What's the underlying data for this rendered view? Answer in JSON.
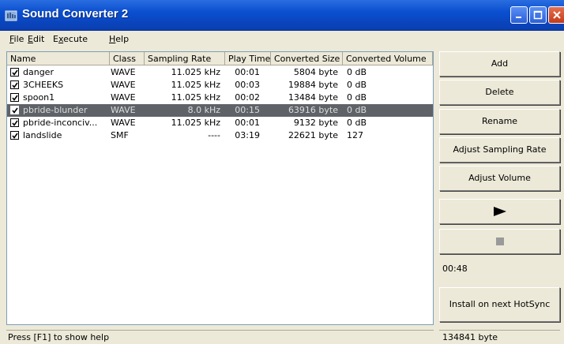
{
  "window": {
    "title": "Sound Converter 2"
  },
  "menu": [
    {
      "label": "File",
      "underline": "F",
      "rest": "ile"
    },
    {
      "label": "Edit",
      "underline": "E",
      "rest": "dit"
    },
    {
      "label": "Execute",
      "prefix": "E",
      "underline": "x",
      "rest": "ecute"
    },
    {
      "label": "Help",
      "underline": "H",
      "rest": "elp"
    }
  ],
  "list": {
    "columns": [
      "Name",
      "Class",
      "Sampling Rate",
      "Play Time",
      "Converted Size",
      "Converted Volume"
    ],
    "rows": [
      {
        "name": "danger",
        "class": "WAVE",
        "rate": "11.025 kHz",
        "time": "00:01",
        "size": "5804 byte",
        "volume": "0 dB",
        "checked": true,
        "selected": false
      },
      {
        "name": "3CHEEKS",
        "class": "WAVE",
        "rate": "11.025 kHz",
        "time": "00:03",
        "size": "19884 byte",
        "volume": "0 dB",
        "checked": true,
        "selected": false
      },
      {
        "name": "spoon1",
        "class": "WAVE",
        "rate": "11.025 kHz",
        "time": "00:02",
        "size": "13484 byte",
        "volume": "0 dB",
        "checked": true,
        "selected": false
      },
      {
        "name": "pbride-blunder",
        "class": "WAVE",
        "rate": "8.0 kHz",
        "time": "00:15",
        "size": "63916 byte",
        "volume": "0 dB",
        "checked": true,
        "selected": true
      },
      {
        "name": "pbride-inconciv...",
        "class": "WAVE",
        "rate": "11.025 kHz",
        "time": "00:01",
        "size": "9132 byte",
        "volume": "0 dB",
        "checked": true,
        "selected": false
      },
      {
        "name": "landslide",
        "class": "SMF",
        "rate": "----",
        "time": "03:19",
        "size": "22621 byte",
        "volume": "127",
        "checked": true,
        "selected": false
      }
    ]
  },
  "buttons": {
    "add": "Add",
    "delete": "Delete",
    "rename": "Rename",
    "adjust_rate": "Adjust Sampling Rate",
    "adjust_volume": "Adjust Volume",
    "install": "Install on next HotSync"
  },
  "total_time": "00:48",
  "status": {
    "help": "Press [F1] to show help",
    "size": "134841 byte"
  }
}
